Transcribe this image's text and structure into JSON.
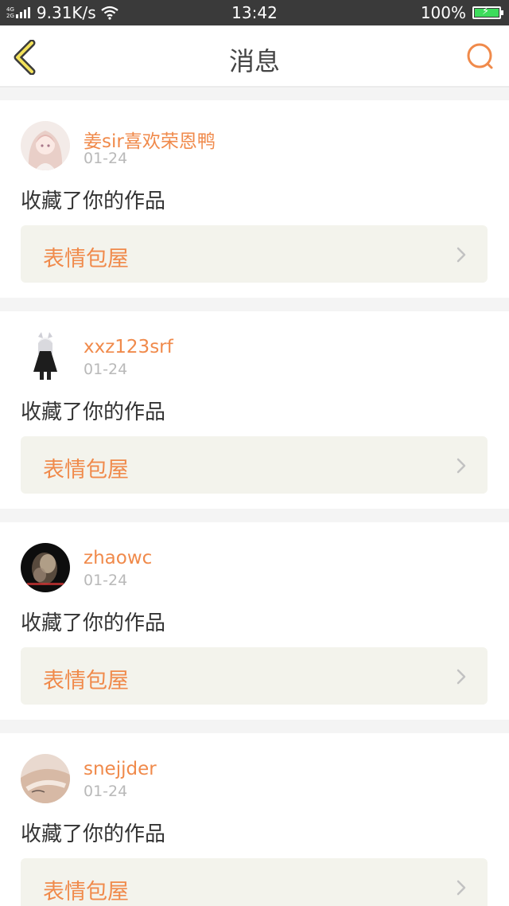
{
  "status_bar": {
    "network_types": [
      "4G",
      "2G"
    ],
    "speed": "9.31K/s",
    "time": "13:42",
    "battery": "100%",
    "battery_level": 1.0
  },
  "header": {
    "title": "消息",
    "back_icon": "chevron-left-icon",
    "search_icon": "search-icon",
    "accent_color": "#f08a4b"
  },
  "messages": [
    {
      "username": "姜sir喜欢荣恩鸭",
      "date": "01-24",
      "action": "收藏了你的作品",
      "work_title": "表情包屋"
    },
    {
      "username": "xxz123srf",
      "date": "01-24",
      "action": "收藏了你的作品",
      "work_title": "表情包屋"
    },
    {
      "username": "zhaowc",
      "date": "01-24",
      "action": "收藏了你的作品",
      "work_title": "表情包屋"
    },
    {
      "username": "snejjder",
      "date": "01-24",
      "action": "收藏了你的作品",
      "work_title": "表情包屋"
    }
  ]
}
